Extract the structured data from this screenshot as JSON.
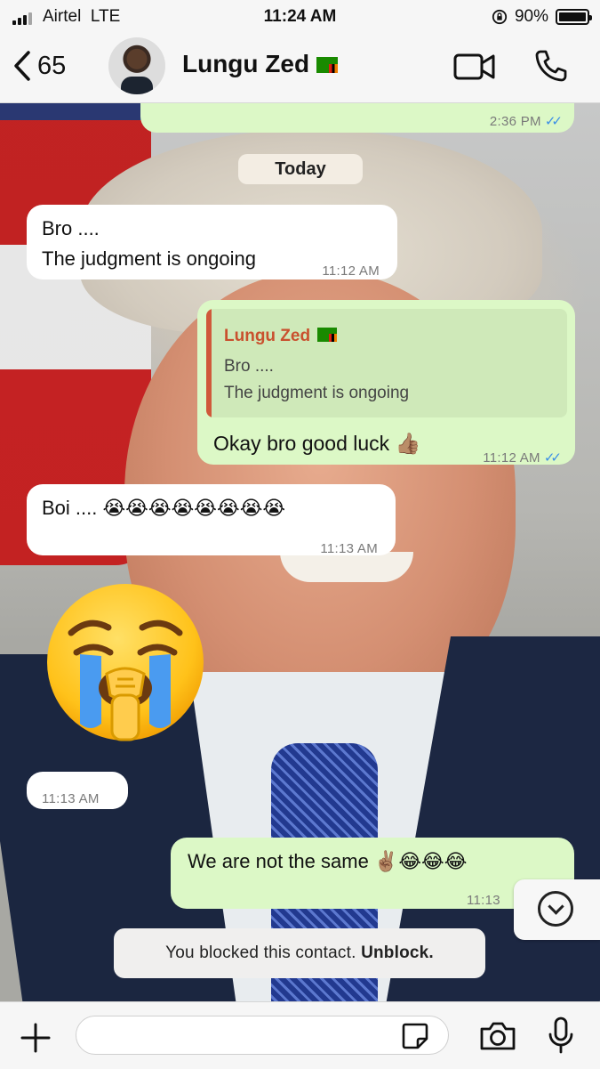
{
  "status_bar": {
    "carrier": "Airtel",
    "network": "LTE",
    "time": "11:24 AM",
    "battery": "90%"
  },
  "header": {
    "back_count": "65",
    "contact_name": "Lungu Zed",
    "contact_flag": "zambia-flag-emoji",
    "icons": [
      "video-call-icon",
      "voice-call-icon"
    ]
  },
  "messages": {
    "prev_out_time": "2:36 PM",
    "date_label": "Today",
    "m1_line1": "Bro ....",
    "m1_line2": "The judgment is ongoing",
    "m1_time": "11:12 AM",
    "m2_quote_name": "Lungu Zed",
    "m2_quote_line1": "Bro ....",
    "m2_quote_line2": "The judgment is ongoing",
    "m2_text": "Okay bro good luck 👍🏽",
    "m2_time": "11:12 AM",
    "m3_text": "Boi .... 😭😭😭😭😭😭😭😭",
    "m3_time": "11:13 AM",
    "m4_emoji": "😭✊",
    "m4_time": "11:13 AM",
    "m5_text": "We are not the same ✌🏽😂😂😂",
    "m5_time": "11:13"
  },
  "system": {
    "blocked_text": "You blocked this contact.",
    "unblock_label": "Unblock."
  },
  "composer": {
    "placeholder": "",
    "icons": [
      "plus-icon",
      "sticker-icon",
      "camera-icon",
      "microphone-icon"
    ]
  },
  "colors": {
    "outgoing_bubble": "#dcf8c6",
    "incoming_bubble": "#ffffff",
    "read_ticks": "#3b8ee6",
    "quote_name": "#c9502e"
  }
}
